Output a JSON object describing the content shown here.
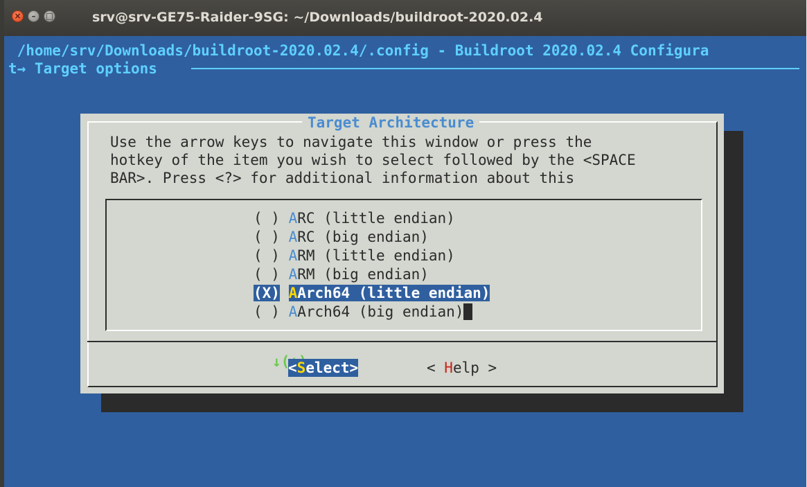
{
  "window": {
    "title": "srv@srv-GE75-Raider-9SG: ~/Downloads/buildroot-2020.02.4"
  },
  "terminal": {
    "header": " /home/srv/Downloads/buildroot-2020.02.4/.config - Buildroot 2020.02.4 Configura",
    "breadcrumb": "t→ Target options"
  },
  "dialog": {
    "title": "Target Architecture",
    "prompt_lines": [
      "Use the arrow keys to navigate this window or press the",
      "hotkey of the item you wish to select followed by the <SPACE",
      "BAR>. Press <?> for additional information about this"
    ],
    "items": [
      {
        "bracket": "( )",
        "hotkey": "A",
        "rest": "RC (little endian)",
        "selected": false
      },
      {
        "bracket": "( )",
        "hotkey": "A",
        "rest": "RC (big endian)",
        "selected": false
      },
      {
        "bracket": "( )",
        "hotkey": "A",
        "rest": "RM (little endian)",
        "selected": false
      },
      {
        "bracket": "( )",
        "hotkey": "A",
        "rest": "RM (big endian)",
        "selected": false
      },
      {
        "bracket": "(X)",
        "hotkey": "A",
        "rest": "Arch64 (little endian)",
        "selected": true
      },
      {
        "bracket": "( )",
        "hotkey": "A",
        "rest": "Arch64 (big endian)",
        "selected": false
      }
    ],
    "more_indicator": "↓(+)",
    "buttons": {
      "select": {
        "open": "<",
        "hotkey": "S",
        "rest": "elect>"
      },
      "help": {
        "open": "< ",
        "hotkey": "H",
        "rest": "elp >"
      }
    }
  },
  "colors": {
    "terminal_bg": "#2f5f9f",
    "dialog_bg": "#d3d7cf",
    "accent_cyan": "#5fd0ff",
    "hotkey_blue": "#4a8cd0",
    "hotkey_selected": "#fcd900",
    "help_hotkey": "#c8231a",
    "more_green": "#6cc94c"
  }
}
